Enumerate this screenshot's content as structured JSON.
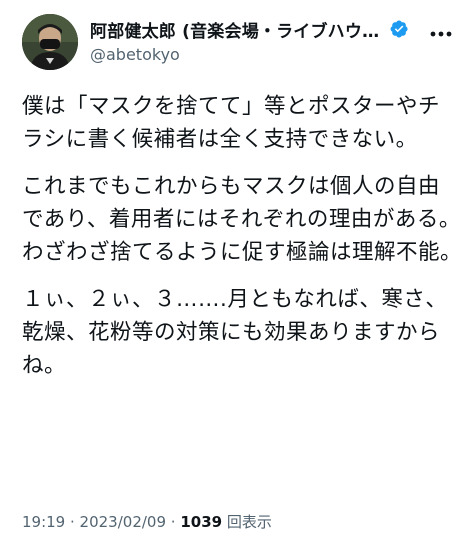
{
  "author": {
    "display_name": "阿部健太郎 (音楽会場・ライブハウス業…",
    "handle": "@abetokyo",
    "verified_color": "#1d9bf0"
  },
  "icons": {
    "verified": "verified-badge-icon",
    "more": "more-horizontal-icon"
  },
  "tweet": {
    "paragraphs": [
      "僕は「マスクを捨てて」等とポスターやチラシに書く候補者は全く支持できない。",
      "これまでもこれからもマスクは個人の自由であり、着用者にはそれぞれの理由がある。わざわざ捨てるように促す極論は理解不能。",
      "１ぃ、２ぃ、３…….月ともなれば、寒さ、乾燥、花粉等の対策にも効果ありますからね。"
    ]
  },
  "meta": {
    "time": "19:19",
    "separator": " · ",
    "date": "2023/02/09",
    "separator2": " · ",
    "views_count": "1039",
    "views_label": " 回表示"
  }
}
